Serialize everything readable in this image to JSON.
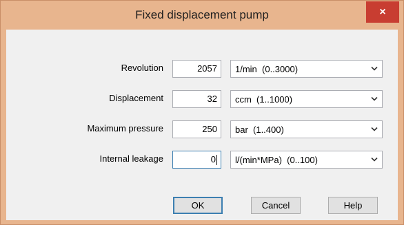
{
  "window": {
    "title": "Fixed displacement pump",
    "close_label": "×"
  },
  "fields": [
    {
      "label": "Revolution",
      "value": "2057",
      "unit": "1/min  (0..3000)"
    },
    {
      "label": "Displacement",
      "value": "32",
      "unit": "ccm  (1..1000)"
    },
    {
      "label": "Maximum pressure",
      "value": "250",
      "unit": "bar  (1..400)"
    },
    {
      "label": "Internal leakage",
      "value": "0",
      "unit": "l/(min*MPa)  (0..100)"
    }
  ],
  "buttons": {
    "ok": "OK",
    "cancel": "Cancel",
    "help": "Help"
  },
  "icons": {
    "close": "close-icon",
    "dropdown": "chevron-down-icon"
  }
}
